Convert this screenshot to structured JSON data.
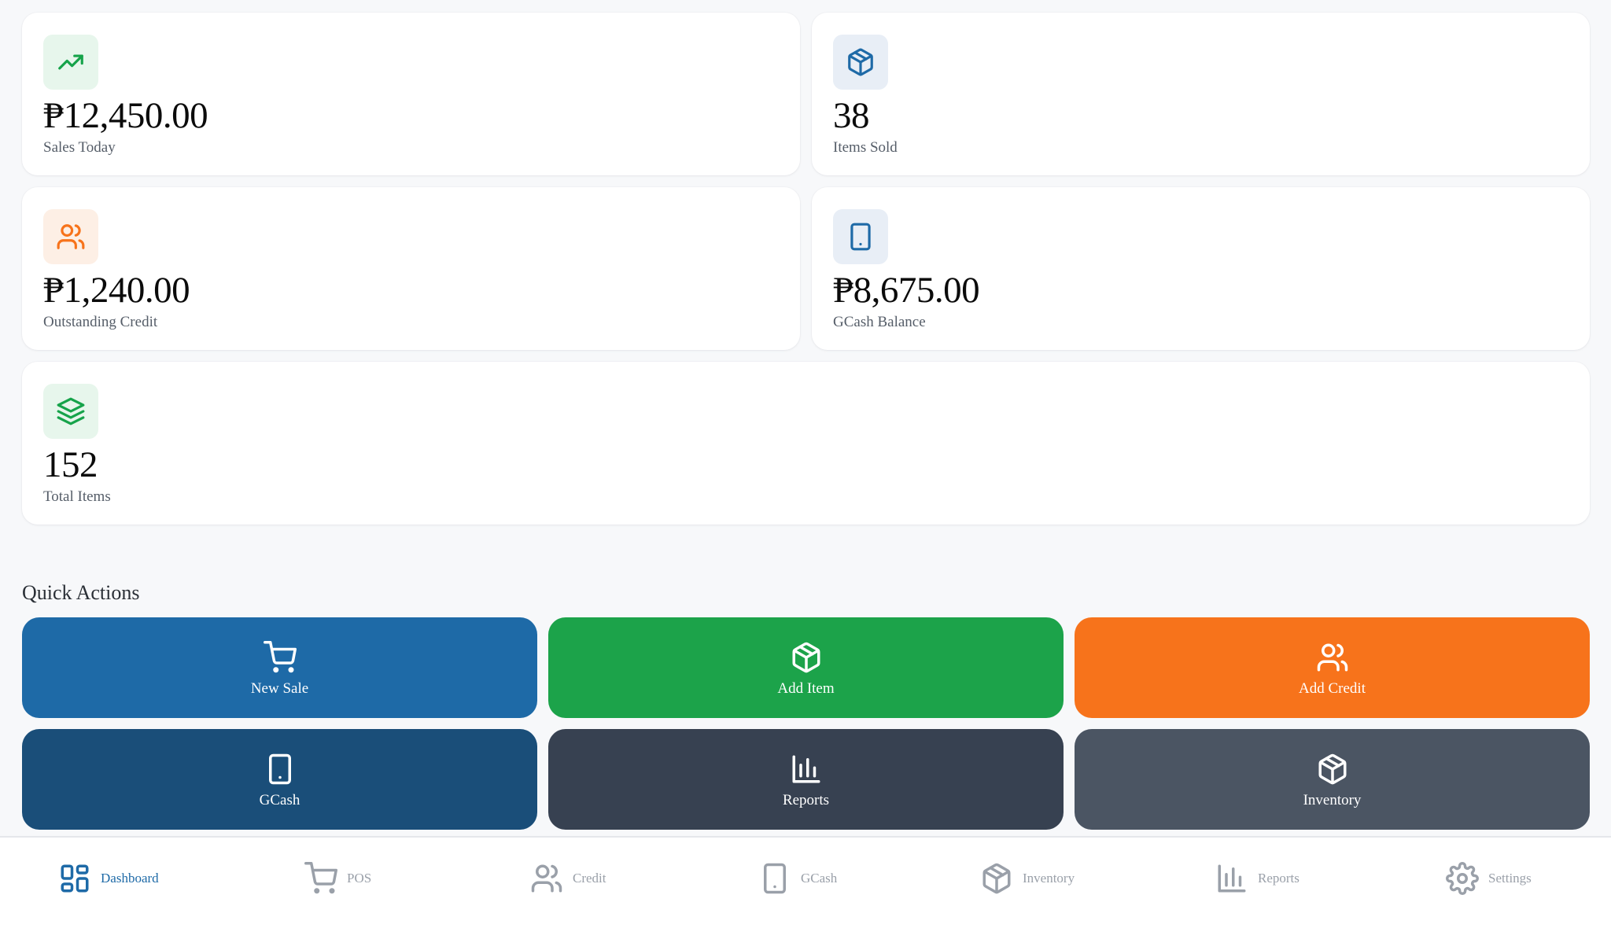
{
  "stats": [
    {
      "value": "₱12,450.00",
      "label": "Sales Today",
      "icon": "trending-up-icon",
      "color": "#16a34a"
    },
    {
      "value": "38",
      "label": "Items Sold",
      "icon": "box-icon",
      "color": "#1e6aa7"
    },
    {
      "value": "₱1,240.00",
      "label": "Outstanding Credit",
      "icon": "users-icon",
      "color": "#f7731b"
    },
    {
      "value": "₱8,675.00",
      "label": "GCash Balance",
      "icon": "smartphone-icon",
      "color": "#1e6aa7"
    },
    {
      "value": "152",
      "label": "Total Items",
      "icon": "layers-icon",
      "color": "#16a34a"
    }
  ],
  "quick_actions": {
    "title": "Quick Actions",
    "items": [
      {
        "label": "New Sale",
        "icon": "cart-icon",
        "color": "#1e6aa7"
      },
      {
        "label": "Add Item",
        "icon": "box-icon",
        "color": "#1ca34a"
      },
      {
        "label": "Add Credit",
        "icon": "users-icon",
        "color": "#f7731b"
      },
      {
        "label": "GCash",
        "icon": "smartphone-icon",
        "color": "#1a4e79"
      },
      {
        "label": "Reports",
        "icon": "bar-chart-icon",
        "color": "#374151"
      },
      {
        "label": "Inventory",
        "icon": "box-icon",
        "color": "#4b5563"
      }
    ]
  },
  "nav": {
    "active": "Dashboard",
    "items": [
      {
        "label": "Dashboard",
        "icon": "dashboard-icon"
      },
      {
        "label": "POS",
        "icon": "cart-icon"
      },
      {
        "label": "Credit",
        "icon": "users-icon"
      },
      {
        "label": "GCash",
        "icon": "smartphone-icon"
      },
      {
        "label": "Inventory",
        "icon": "box-icon"
      },
      {
        "label": "Reports",
        "icon": "bar-chart-icon"
      },
      {
        "label": "Settings",
        "icon": "gear-icon"
      }
    ]
  }
}
